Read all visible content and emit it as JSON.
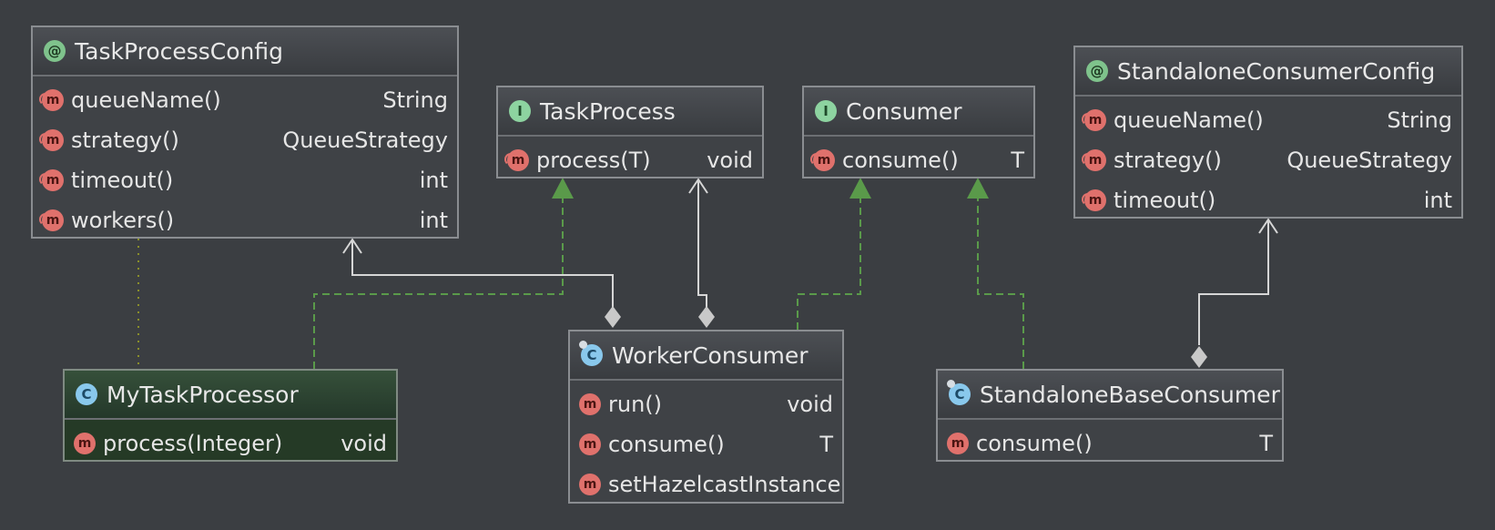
{
  "task_process_config": {
    "badge": "@",
    "title": "TaskProcessConfig",
    "methods": [
      {
        "name": "queueName()",
        "type": "String"
      },
      {
        "name": "strategy()",
        "type": "QueueStrategy"
      },
      {
        "name": "timeout()",
        "type": "int"
      },
      {
        "name": "workers()",
        "type": "int"
      }
    ]
  },
  "task_process": {
    "badge": "I",
    "title": "TaskProcess",
    "methods": [
      {
        "name": "process(T)",
        "type": "void"
      }
    ]
  },
  "consumer": {
    "badge": "I",
    "title": "Consumer",
    "methods": [
      {
        "name": "consume()",
        "type": "T"
      }
    ]
  },
  "standalone_consumer_config": {
    "badge": "@",
    "title": "StandaloneConsumerConfig",
    "methods": [
      {
        "name": "queueName()",
        "type": "String"
      },
      {
        "name": "strategy()",
        "type": "QueueStrategy"
      },
      {
        "name": "timeout()",
        "type": "int"
      }
    ]
  },
  "my_task_processor": {
    "badge": "C",
    "title": "MyTaskProcessor",
    "methods": [
      {
        "name": "process(Integer)",
        "type": "void"
      }
    ]
  },
  "worker_consumer": {
    "badge": "C",
    "title": "WorkerConsumer",
    "methods": [
      {
        "name": "run()",
        "type": "void"
      },
      {
        "name": "consume()",
        "type": "T"
      },
      {
        "name": "setHazelcastInstance",
        "type": ""
      }
    ]
  },
  "standalone_base_consumer": {
    "badge": "C",
    "title": "StandaloneBaseConsumer",
    "methods": [
      {
        "name": "consume()",
        "type": "T"
      }
    ]
  },
  "colors": {
    "background": "#3b3e42",
    "realization": "#5a9a4a",
    "association": "#d6d6d6",
    "note_link": "#8a8f2a"
  },
  "icons": {
    "annotation": "annotation-icon",
    "interface": "interface-icon",
    "class": "class-icon",
    "method": "method-icon"
  }
}
